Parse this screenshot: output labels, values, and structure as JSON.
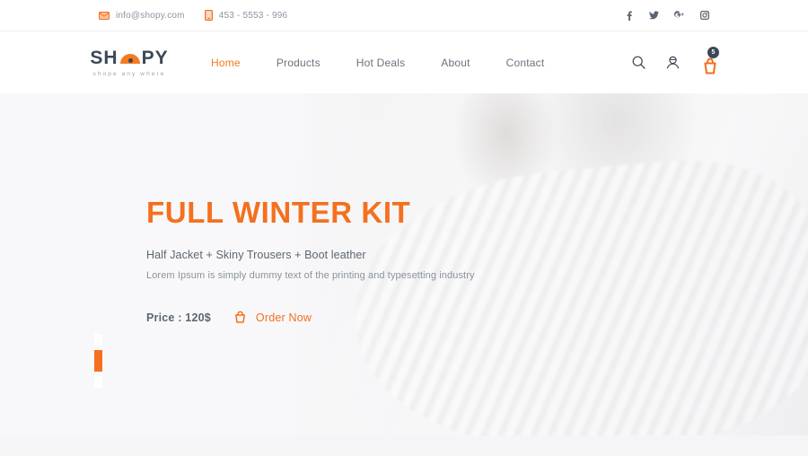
{
  "topbar": {
    "email": "info@shopy.com",
    "phone": "453 - 5553 - 996",
    "email_icon": "envelope-icon",
    "phone_icon": "mobile-phone-icon",
    "social": [
      {
        "name": "facebook-icon",
        "glyph": "f"
      },
      {
        "name": "twitter-icon",
        "glyph": "ᵛ"
      },
      {
        "name": "google-plus-icon",
        "glyph": "g"
      },
      {
        "name": "instagram-icon",
        "glyph": "▣"
      }
    ]
  },
  "header": {
    "logo": {
      "text_left": "SH",
      "text_right": "PY",
      "tagline": "shope any where"
    },
    "nav": [
      {
        "label": "Home",
        "active": true
      },
      {
        "label": "Products",
        "active": false
      },
      {
        "label": "Hot Deals",
        "active": false
      },
      {
        "label": "About",
        "active": false
      },
      {
        "label": "Contact",
        "active": false
      }
    ],
    "icons": {
      "search": "search-icon",
      "account": "user-account-icon",
      "cart": "shopping-basket-icon",
      "cart_count": "5"
    }
  },
  "hero": {
    "title": "FULL WINTER KIT",
    "subtitle": "Half Jacket + Skiny Trousers + Boot leather",
    "description": "Lorem Ipsum is simply dummy text of the printing and typesetting industry",
    "price_label": "Price : 120$",
    "order_label": "Order Now",
    "order_icon": "basket-outline-icon",
    "slides": [
      {
        "active": false
      },
      {
        "active": true
      },
      {
        "active": false
      }
    ]
  },
  "colors": {
    "accent": "#f4701f",
    "dark": "#3c4858",
    "muted": "#8b939c",
    "text": "#5d6670"
  }
}
